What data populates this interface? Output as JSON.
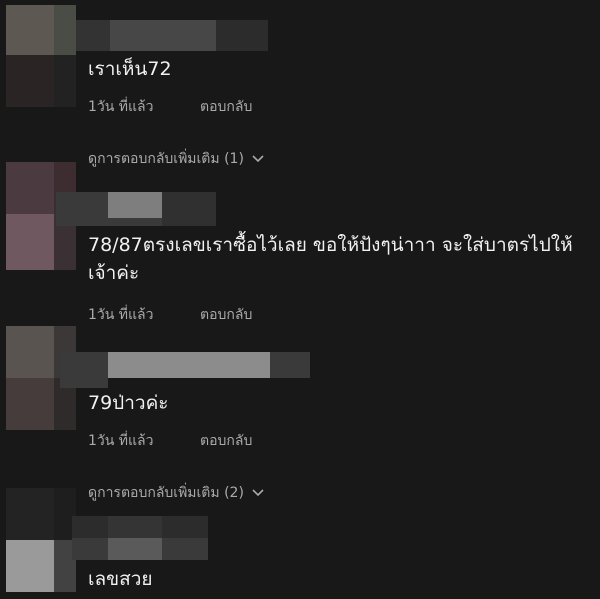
{
  "comments": [
    {
      "text": "เราเห็น72",
      "time": "1วัน ที่แล้ว",
      "reply_label": "ตอบกลับ"
    },
    {
      "text": "78/87ตรงเลขเราซื้อไว้เลย ขอให้ปังๆน่าาา จะใส่บาตรไปให้ เจ้าค่ะ",
      "time": "1วัน ที่แล้ว",
      "reply_label": "ตอบกลับ"
    },
    {
      "text": "79ป่าวค่ะ",
      "time": "1วัน ที่แล้ว",
      "reply_label": "ตอบกลับ"
    },
    {
      "text": "เลขสวย"
    }
  ],
  "view_more": [
    {
      "label": "ดูการตอบกลับเพิ่มเติม (1)"
    },
    {
      "label": "ดูการตอบกลับเพิ่มเติม (2)"
    }
  ],
  "icons": {
    "expand": "chevron-down-icon"
  },
  "colors": {
    "background": "#181818",
    "text": "#f1f1f1",
    "muted": "#aaaaaa"
  }
}
